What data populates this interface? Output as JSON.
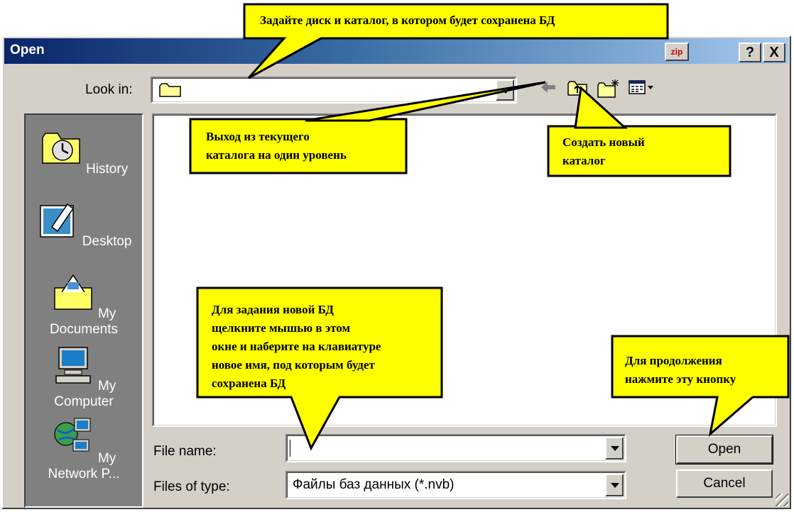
{
  "window": {
    "title": "Open",
    "zip_label": "zip",
    "help_label": "?",
    "close_label": "X"
  },
  "look_in": {
    "label": "Look in:",
    "value": ""
  },
  "toolbar": {
    "icons": [
      "back-arrow-icon",
      "up-folder-icon",
      "new-folder-icon",
      "view-menu-icon"
    ]
  },
  "places": [
    {
      "label": "History",
      "icon": "history-icon"
    },
    {
      "label": "Desktop",
      "icon": "desktop-icon"
    },
    {
      "label": "My Documents",
      "icon": "my-documents-icon"
    },
    {
      "label": "My Computer",
      "icon": "my-computer-icon"
    },
    {
      "label": "My Network P...",
      "icon": "my-network-places-icon"
    }
  ],
  "file_name": {
    "label": "File name:",
    "value": ""
  },
  "files_of_type": {
    "label": "Files of type:",
    "value": "Файлы баз данных (*.nvb)"
  },
  "buttons": {
    "open": "Open",
    "cancel": "Cancel"
  },
  "callouts": {
    "top": "Задайте диск и каталог, в котором будет сохранена БД",
    "up_line1": "Выход из текущего",
    "up_line2": "каталога на один уровень",
    "newdir_line1": "Создать новый",
    "newdir_line2": "каталог",
    "newdb_lines": [
      "Для задания новой БД",
      "щелкните мышью  в этом",
      "окне и наберите на клавиатуре",
      "новое имя, под которым будет",
      "сохранена БД"
    ],
    "cont_line1": "Для продолжения",
    "cont_line2": "нажмите эту кнопку"
  },
  "colors": {
    "callout_fill": "#ffff00",
    "title_start": "#0a246a",
    "dialog_bg": "#d4d0c8",
    "places_bg": "#808080"
  }
}
